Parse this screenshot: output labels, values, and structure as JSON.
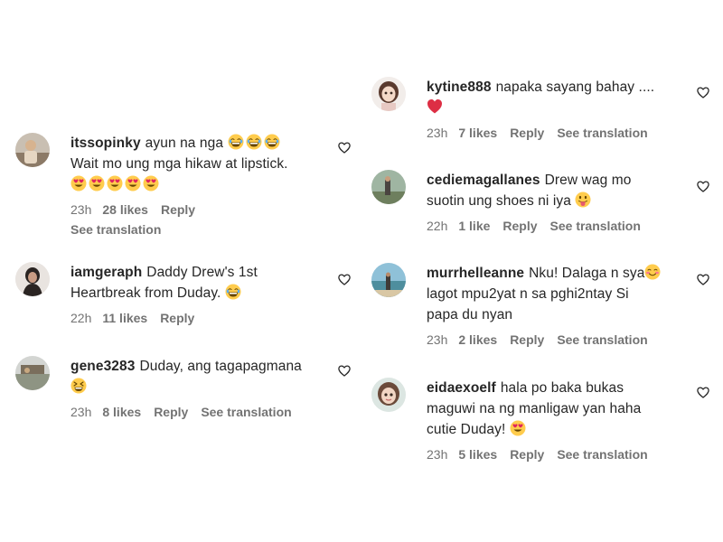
{
  "left_column": [
    {
      "username": "itssopinky",
      "line1": "ayun na nga",
      "line2": "Wait mo ung mga hikaw at lipstick.",
      "time": "23h",
      "likes": "28 likes",
      "reply": "Reply",
      "see_translation": "See translation",
      "emojis": [
        "laughing-face-emoji",
        "heart-eyes-emoji"
      ]
    },
    {
      "username": "iamgeraph",
      "line1": "Daddy Drew's 1st",
      "line2": "Heartbreak from Duday.",
      "time": "22h",
      "likes": "11 likes",
      "reply": "Reply",
      "emojis": [
        "laughing-face-emoji"
      ]
    },
    {
      "username": "gene3283",
      "line1": "Duday, ang tagapagmana",
      "time": "23h",
      "likes": "8 likes",
      "reply": "Reply",
      "see_translation": "See translation",
      "emojis": [
        "grinning-squint-emoji"
      ]
    }
  ],
  "right_column": [
    {
      "username": "kytine888",
      "line1": "napaka sayang bahay ....",
      "time": "23h",
      "likes": "7 likes",
      "reply": "Reply",
      "see_translation": "See translation",
      "emojis": [
        "red-heart-emoji"
      ]
    },
    {
      "username": "cediemagallanes",
      "line1": "Drew wag mo",
      "line2": "suotin ung shoes ni iya",
      "time": "22h",
      "likes": "1 like",
      "reply": "Reply",
      "see_translation": "See translation",
      "emojis": [
        "tongue-face-emoji"
      ]
    },
    {
      "username": "murrhelleanne",
      "line1": "Nku! Dalaga n sya",
      "line2": "lagot mpu2yat n sa pghi2ntay Si",
      "line3": "papa du nyan",
      "time": "23h",
      "likes": "2 likes",
      "reply": "Reply",
      "see_translation": "See translation",
      "emojis": [
        "blushing-smile-emoji"
      ]
    },
    {
      "username": "eidaexoelf",
      "line1": "hala po baka bukas",
      "line2": "maguwi na ng manligaw yan haha",
      "line3": "cutie Duday!",
      "time": "23h",
      "likes": "5 likes",
      "reply": "Reply",
      "see_translation": "See translation",
      "emojis": [
        "heart-eyes-emoji"
      ]
    }
  ],
  "icons": {
    "like": "heart-outline-icon"
  },
  "colors": {
    "text": "#262626",
    "meta": "#737373",
    "background": "#ffffff",
    "emoji_yellow": "#FFCC4D",
    "heart_red": "#E0245E"
  }
}
